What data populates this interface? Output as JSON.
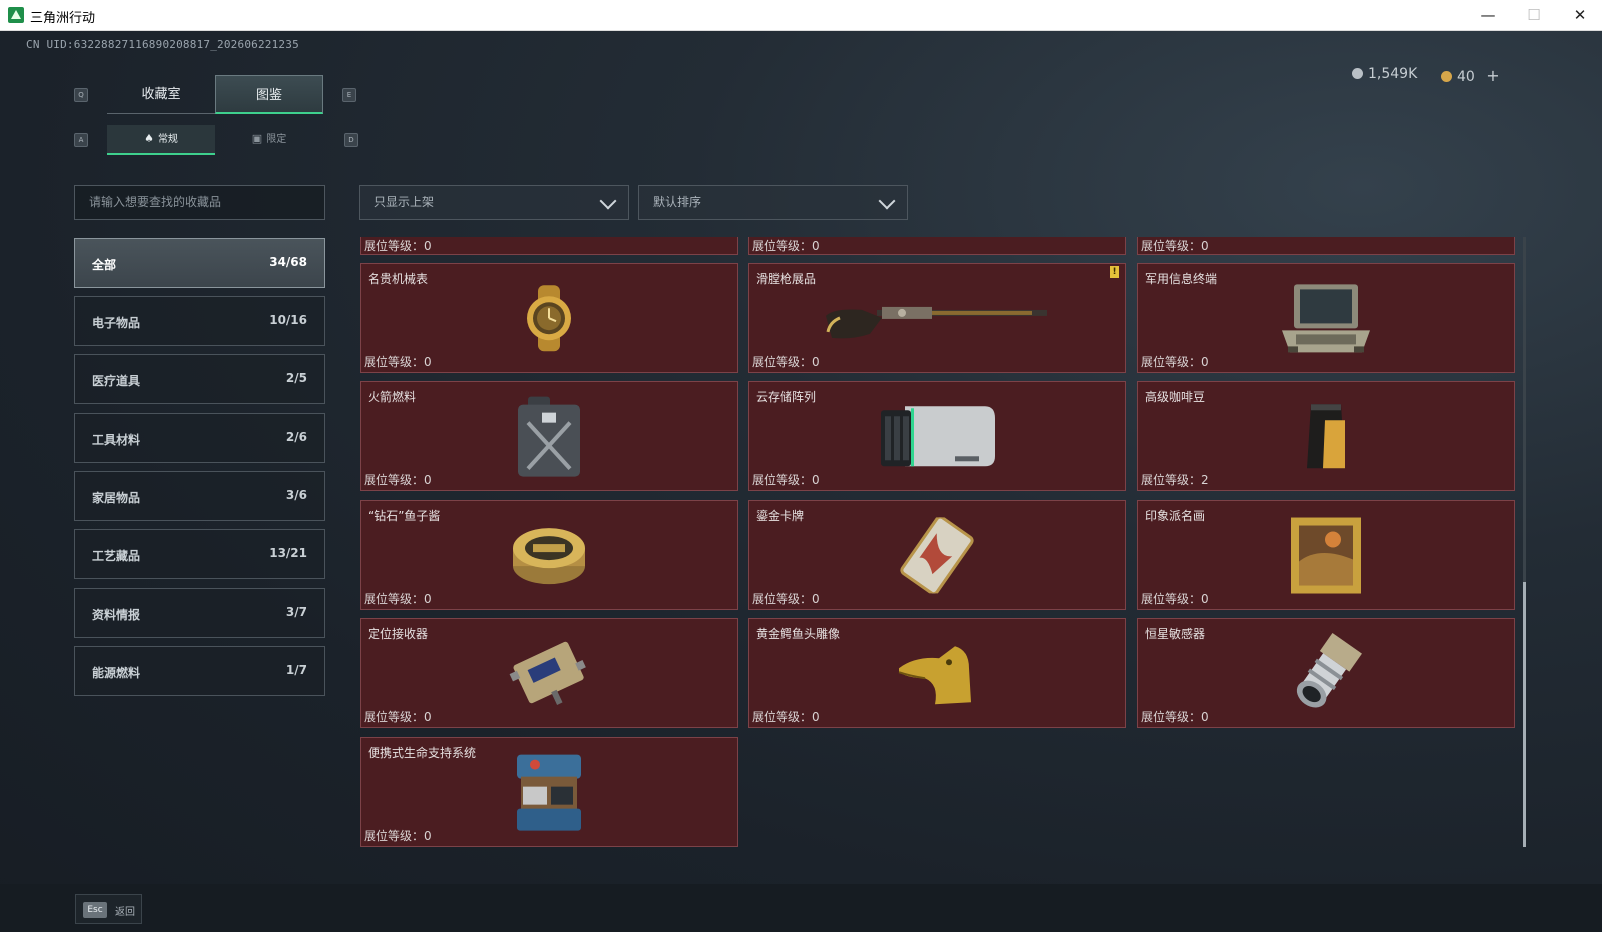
{
  "window": {
    "title": "三角洲行动",
    "minimize": "—",
    "maximize": "☐",
    "close": "✕"
  },
  "uid": "CN UID:6322882711689020881​7_202606221235",
  "currency": {
    "silver": "1,549K",
    "gold": "40",
    "add": "+",
    "silver_color": "#b9c0c6",
    "gold_color": "#d6a64a"
  },
  "keyhints": {
    "q": "Q",
    "e": "E",
    "a": "A",
    "d": "D"
  },
  "main_tabs": [
    {
      "label": "收藏室"
    },
    {
      "label": "图鉴"
    }
  ],
  "sub_tabs": [
    {
      "label": "常规",
      "icon": "lamp-icon"
    },
    {
      "label": "限定",
      "icon": "picture-icon"
    }
  ],
  "search": {
    "placeholder": "请输入想要查找的收藏品"
  },
  "filters": {
    "show": "只显示上架",
    "sort": "默认排序"
  },
  "categories": [
    {
      "label": "全部",
      "count": "34/68"
    },
    {
      "label": "电子物品",
      "count": "10/16"
    },
    {
      "label": "医疗道具",
      "count": "2/5"
    },
    {
      "label": "工具材料",
      "count": "2/6"
    },
    {
      "label": "家居物品",
      "count": "3/6"
    },
    {
      "label": "工艺藏品",
      "count": "13/21"
    },
    {
      "label": "资料情报",
      "count": "3/7"
    },
    {
      "label": "能源燃料",
      "count": "1/7"
    }
  ],
  "level_prefix": "展位等级：",
  "partial_row": [
    {
      "level": "展位等级：0"
    },
    {
      "level": "展位等级：0"
    },
    {
      "level": "展位等级：0"
    }
  ],
  "items": [
    {
      "name": "名贵机械表",
      "level": "展位等级：0",
      "icon": "watch-icon"
    },
    {
      "name": "滑膛枪展品",
      "level": "展位等级：0",
      "icon": "musket-icon",
      "badge": "!"
    },
    {
      "name": "军用信息终端",
      "level": "展位等级：0",
      "icon": "terminal-icon"
    },
    {
      "name": "火箭燃料",
      "level": "展位等级：0",
      "icon": "jerrycan-icon"
    },
    {
      "name": "云存储阵列",
      "level": "展位等级：0",
      "icon": "server-icon"
    },
    {
      "name": "高级咖啡豆",
      "level": "展位等级：2",
      "icon": "coffee-bag-icon"
    },
    {
      "name": "“钻石”鱼子酱",
      "level": "展位等级：0",
      "icon": "caviar-tin-icon"
    },
    {
      "name": "鎏金卡牌",
      "level": "展位等级：0",
      "icon": "card-icon"
    },
    {
      "name": "印象派名画",
      "level": "展位等级：0",
      "icon": "painting-icon"
    },
    {
      "name": "定位接收器",
      "level": "展位等级：0",
      "icon": "receiver-icon"
    },
    {
      "name": "黄金鳄鱼头雕像",
      "level": "展位等级：0",
      "icon": "crocodile-head-icon"
    },
    {
      "name": "恒星敏感器",
      "level": "展位等级：0",
      "icon": "star-sensor-icon"
    },
    {
      "name": "便携式生命支持系统",
      "level": "展位等级：0",
      "icon": "life-support-icon"
    }
  ],
  "footer": {
    "key": "Esc",
    "label": "返回"
  },
  "colors": {
    "accent": "#3ed08d",
    "card_bg": "#4b1d21",
    "card_border": "#7c4248"
  }
}
